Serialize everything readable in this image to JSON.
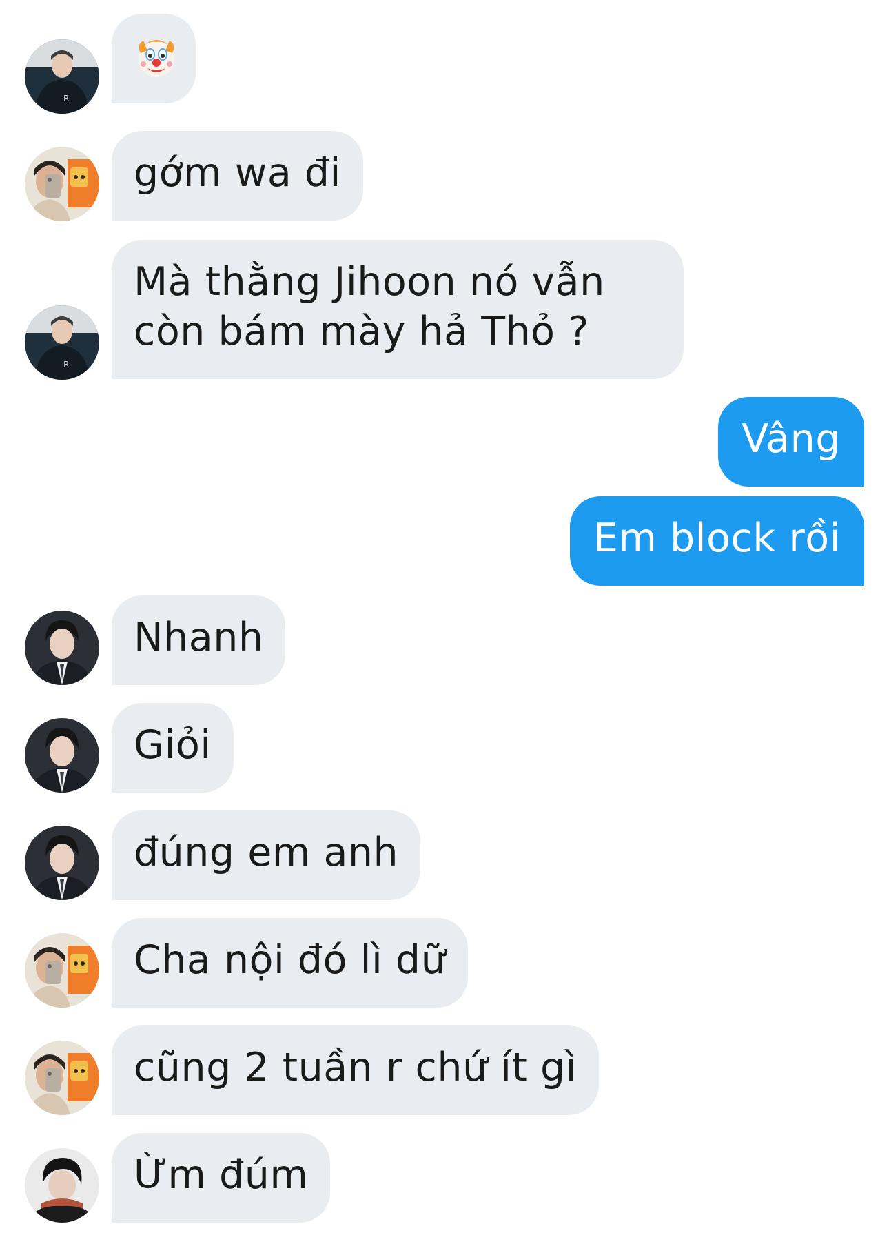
{
  "messages": [
    {
      "id": "m1",
      "side": "in",
      "avatar": "avatar-black-hoodie",
      "text": "",
      "emoji": "clown-face"
    },
    {
      "id": "m2",
      "side": "in",
      "avatar": "avatar-mirror-selfie",
      "text": "gớm wa đi"
    },
    {
      "id": "m3",
      "side": "in",
      "avatar": "avatar-black-hoodie",
      "line1": "Mà thằng Jihoon nó vẫn",
      "line2": "còn bám mày hả Thỏ ?"
    },
    {
      "id": "m4",
      "side": "out",
      "text": "Vâng"
    },
    {
      "id": "m5",
      "side": "out",
      "text": "Em block rồi"
    },
    {
      "id": "m6",
      "side": "in",
      "avatar": "avatar-suit",
      "text": "Nhanh"
    },
    {
      "id": "m7",
      "side": "in",
      "avatar": "avatar-suit",
      "text": "Giỏi"
    },
    {
      "id": "m8",
      "side": "in",
      "avatar": "avatar-suit",
      "text": "đúng em anh"
    },
    {
      "id": "m9",
      "side": "in",
      "avatar": "avatar-mirror-selfie",
      "text": "Cha nội đó lì dữ"
    },
    {
      "id": "m10",
      "side": "in",
      "avatar": "avatar-mirror-selfie",
      "text": "cũng 2 tuần r chứ ít gì"
    },
    {
      "id": "m11",
      "side": "in",
      "avatar": "avatar-scarf",
      "text": "Ừm đúm"
    }
  ],
  "colors": {
    "incoming_bubble": "#e9edf1",
    "outgoing_bubble": "#1d9bf0",
    "incoming_text": "#1a1a1a",
    "outgoing_text": "#ffffff"
  }
}
